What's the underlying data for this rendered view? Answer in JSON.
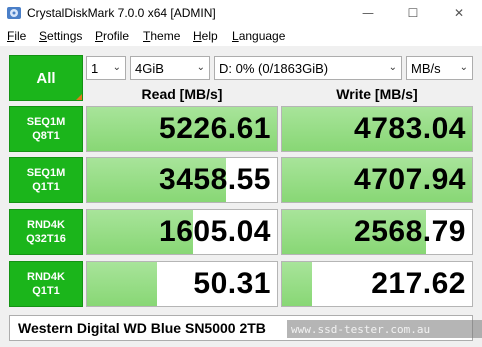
{
  "window": {
    "title": "CrystalDiskMark 7.0.0 x64 [ADMIN]",
    "min_glyph": "—",
    "max_glyph": "☐",
    "close_glyph": "✕"
  },
  "menu": [
    {
      "key": "F",
      "rest": "ile"
    },
    {
      "key": "S",
      "rest": "ettings"
    },
    {
      "key": "P",
      "rest": "rofile"
    },
    {
      "key": "T",
      "rest": "heme"
    },
    {
      "key": "H",
      "rest": "elp"
    },
    {
      "key": "L",
      "rest": "anguage"
    }
  ],
  "controls": {
    "all_label": "All",
    "count": "1",
    "size": "4GiB",
    "drive": "D: 0% (0/1863GiB)",
    "unit": "MB/s",
    "arrow_glyph": "⌄"
  },
  "headers": {
    "read": "Read [MB/s]",
    "write": "Write [MB/s]"
  },
  "rows": [
    {
      "line1": "SEQ1M",
      "line2": "Q8T1",
      "read": "5226.61",
      "write": "4783.04",
      "read_fill": 1.0,
      "write_fill": 1.0
    },
    {
      "line1": "SEQ1M",
      "line2": "Q1T1",
      "read": "3458.55",
      "write": "4707.94",
      "read_fill": 0.73,
      "write_fill": 1.0
    },
    {
      "line1": "RND4K",
      "line2": "Q32T16",
      "read": "1605.04",
      "write": "2568.79",
      "read_fill": 0.56,
      "write_fill": 0.76
    },
    {
      "line1": "RND4K",
      "line2": "Q1T1",
      "read": "50.31",
      "write": "217.62",
      "read_fill": 0.37,
      "write_fill": 0.16
    }
  ],
  "comment": "Western Digital WD Blue SN5000 2TB",
  "watermark": "www.ssd-tester.com.au",
  "colors": {
    "accent_green": "#1bb51b",
    "bar_green": "#88d775",
    "corner_orange": "#e07a1a"
  }
}
